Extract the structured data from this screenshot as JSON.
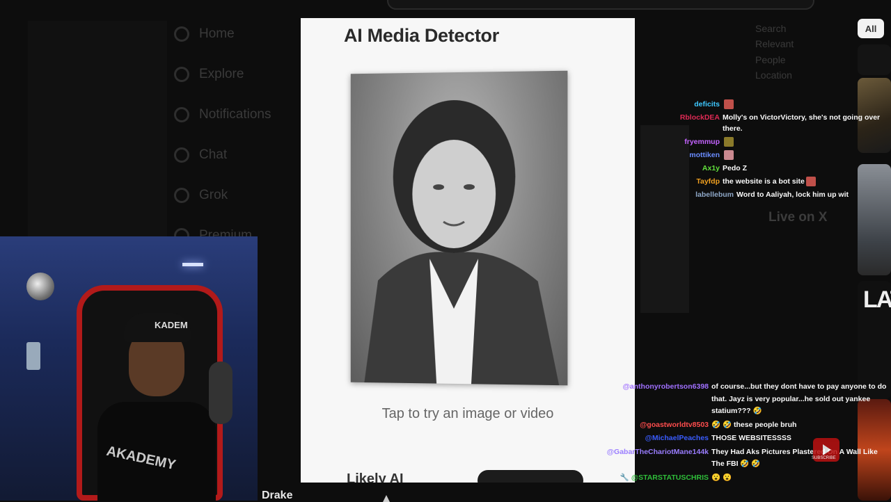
{
  "background_app": {
    "nav_items": [
      "Home",
      "Explore",
      "Notifications",
      "Chat",
      "Grok",
      "Premium"
    ],
    "right_column": [
      "Search",
      "Relevant",
      "People",
      "Location",
      "Live on X"
    ],
    "live_heading": "Live on X"
  },
  "filter_chip": {
    "label": "All"
  },
  "detector": {
    "title": "AI Media Detector",
    "hint": "Tap to try an image or video",
    "bottom_text": "Likely AI"
  },
  "webcam": {
    "cap_text": "KADEM",
    "shirt_text": "AKADEMY",
    "caption": "Drake"
  },
  "chat_top": [
    {
      "user": "deficits",
      "color": "#3ec8ff",
      "message": "",
      "emote": "#c0504a"
    },
    {
      "user": "RblockDEA",
      "color": "#e02a55",
      "message": "Molly's on VictorVictory, she's not going over there.",
      "emote": ""
    },
    {
      "user": "fryemmup",
      "color": "#c463ff",
      "message": "",
      "emote": "#8a7a2a"
    },
    {
      "user": "mottiken",
      "color": "#6a8cff",
      "message": "",
      "emote": "#c9888f"
    },
    {
      "user": "Ax1y",
      "color": "#62e03c",
      "message": "Pedo Z",
      "emote": ""
    },
    {
      "user": "Tayfdp",
      "color": "#f0a020",
      "message": "the website is a bot site",
      "emote": "#c0504a"
    },
    {
      "user": "labellebum",
      "color": "#8fa8c8",
      "message": "Word to Aaliyah, lock him up wit",
      "emote": ""
    }
  ],
  "chat_bottom": [
    {
      "user": "@anthonyrobertson6398",
      "color": "#a070ff",
      "message": "of course...but they dont have to pay anyone to do that. Jayz is very popular...he sold out yankee statium??? 🤣"
    },
    {
      "user": "@goastworldtv8503",
      "color": "#ff4d4d",
      "message": "🤣 🤣 these people bruh"
    },
    {
      "user": "@MichaelPeaches",
      "color": "#3a5cff",
      "message": "THOSE WEBSITESSSS"
    },
    {
      "user": "@GabarTheChariotMane144k",
      "color": "#9a7dff",
      "message": "They Had Aks Pictures Plastered On A Wall Like The FBI 🤣 🤣"
    },
    {
      "user": "🔧 @STARSTATUSCHRIS",
      "color": "#2fbf3a",
      "message": "😮 😮"
    }
  ],
  "subscribe_label": "SUBSCRIBE",
  "colors": {
    "card_bg": "#f7f7f7",
    "page_bg": "#0d0d0d",
    "chair_red": "#b21a1a"
  }
}
